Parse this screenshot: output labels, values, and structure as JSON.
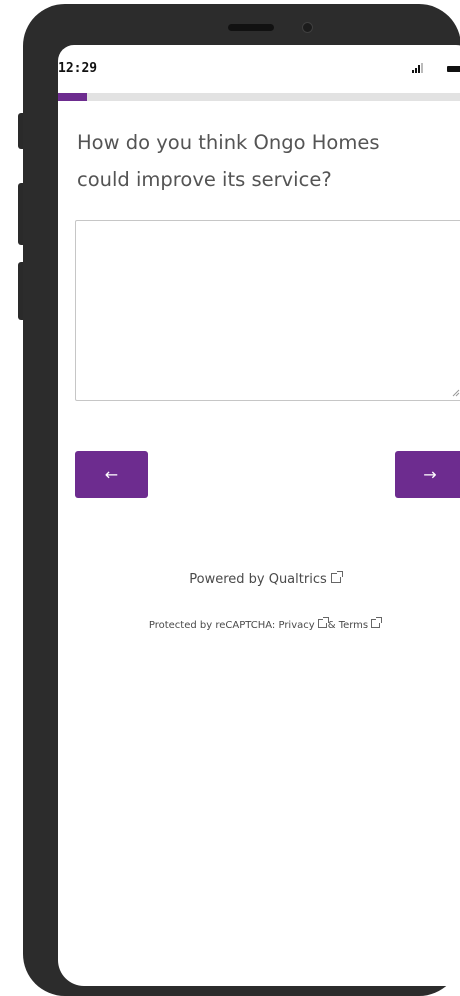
{
  "status_bar": {
    "time": "12:29"
  },
  "survey": {
    "progress_percent": 7,
    "question": "How do you think Ongo Homes could improve its service?",
    "answer_value": "",
    "back_label": "←",
    "next_label": "→"
  },
  "footer": {
    "powered_by": "Powered by Qualtrics",
    "protected_prefix": "Protected by reCAPTCHA:",
    "privacy_link": "Privacy",
    "amp": "&",
    "terms_link": "Terms"
  },
  "colors": {
    "accent": "#6d2c8f",
    "frame": "#2c2c2c",
    "track": "#e2e2e2"
  },
  "icons": {
    "back": "arrow-left-icon",
    "next": "arrow-right-icon",
    "external": "external-link-icon"
  }
}
